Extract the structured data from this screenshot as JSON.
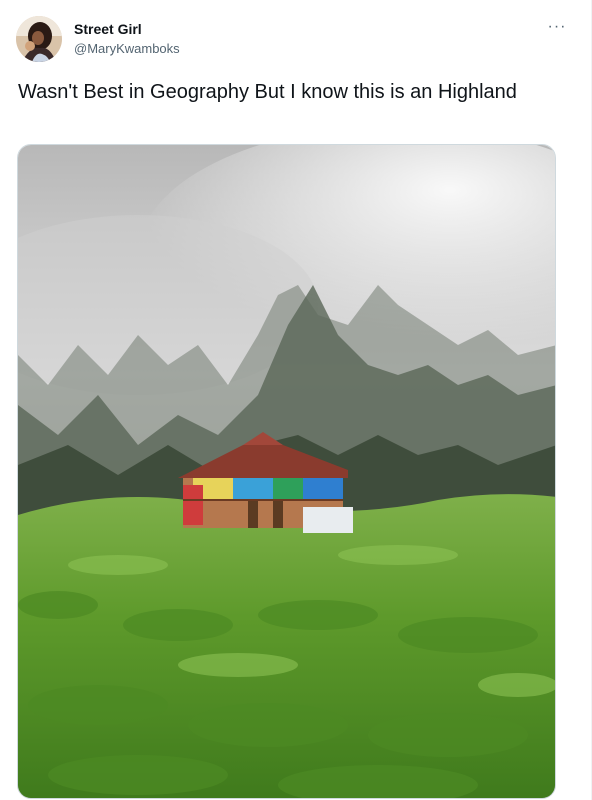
{
  "tweet": {
    "display_name": "Street Girl",
    "handle": "@MaryKwamboks",
    "text": "Wasn't Best in Geography But I know this is an Highland",
    "more_icon": "more-horizontal-icon",
    "more_label": "···"
  },
  "colors": {
    "text_primary": "#0f1419",
    "text_secondary": "#536471",
    "border": "#cfd9de"
  }
}
